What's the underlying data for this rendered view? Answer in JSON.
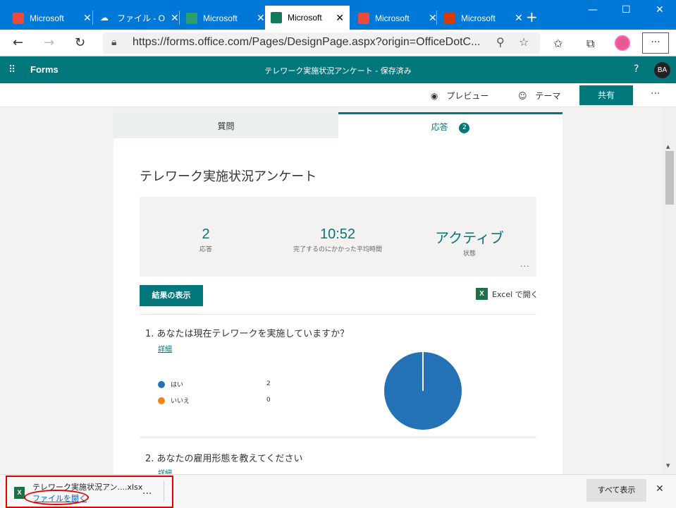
{
  "browser": {
    "tabs": [
      {
        "title": "Microsoft",
        "icon": "office-icon",
        "color": "#e74c3c"
      },
      {
        "title": "ファイル - O",
        "icon": "onedrive-icon",
        "color": "#ffffff"
      },
      {
        "title": "Microsoft",
        "icon": "forms-icon",
        "color": "#2e9e6e"
      },
      {
        "title": "Microsoft",
        "icon": "forms-icon",
        "color": "#0f7a5c"
      },
      {
        "title": "Microsoft",
        "icon": "office-icon",
        "color": "#e74c3c"
      },
      {
        "title": "Microsoft",
        "icon": "office-icon",
        "color": "#d83b01"
      }
    ],
    "url": "https://forms.office.com/Pages/DesignPage.aspx?origin=OfficeDotC..."
  },
  "forms": {
    "brand": "Forms",
    "doc_title": "テレワーク実施状況アンケート - 保存済み",
    "help": "?",
    "avatar": "BA",
    "preview": "プレビュー",
    "theme": "テーマ",
    "share": "共有"
  },
  "tabs": {
    "questions": "質問",
    "responses": "応答",
    "response_count": "2"
  },
  "form": {
    "title": "テレワーク実施状況アンケート",
    "stats": [
      {
        "value": "2",
        "label": "応答"
      },
      {
        "value": "10:52",
        "label": "完了するのにかかった平均時間"
      },
      {
        "value": "アクティブ",
        "label": "状態"
      }
    ],
    "results_button": "結果の表示",
    "excel_open": "Excel で開く"
  },
  "questions": [
    {
      "text": "1.  あなたは現在テレワークを実施していますか？",
      "detail": "詳細",
      "options": [
        {
          "label": "はい",
          "count": 2,
          "color": "#2372b5"
        },
        {
          "label": "いいえ",
          "count": 0,
          "color": "#f08519"
        }
      ]
    },
    {
      "text": "2.  あなたの雇用形態を教えてください",
      "detail": "詳細"
    }
  ],
  "download": {
    "filename": "テレワーク実施状況アン....xlsx",
    "open_link": "ファイルを開く",
    "more": "...",
    "show_all": "すべて表示"
  }
}
